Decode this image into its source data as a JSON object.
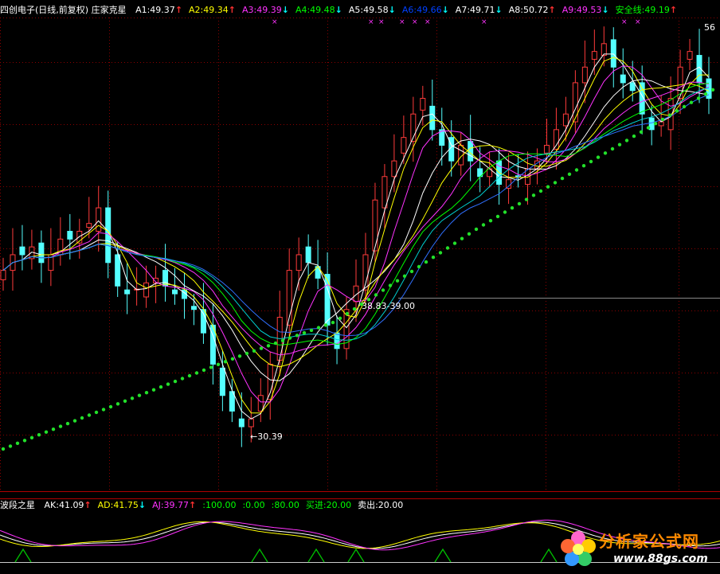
{
  "colors": {
    "background": "#000000",
    "up_candle": "#ff3b3b",
    "down_candle": "#54ffff",
    "safety_dots": "#22e02a",
    "grid": "#8a0000",
    "ma_white": "#ffffff",
    "ma_yellow": "#ffff00",
    "ma_magenta": "#ff33ff",
    "ma_green": "#00ff00",
    "ma_blue": "#3070ff",
    "ma_cyan": "#00d0d0",
    "triangle": "#00c000"
  },
  "main_header": {
    "title": "四创电子(日线,前复权) 庄家克星",
    "items": [
      {
        "label": "A1:49.37",
        "arrow": "↑",
        "color": "#ffffff",
        "arrow_color": "#ff3030"
      },
      {
        "label": "A2:49.34",
        "arrow": "↑",
        "color": "#ffff00",
        "arrow_color": "#ff3030"
      },
      {
        "label": "A3:49.39",
        "arrow": "↓",
        "color": "#ff33ff",
        "arrow_color": "#00ffff"
      },
      {
        "label": "A4:49.48",
        "arrow": "↓",
        "color": "#00ff00",
        "arrow_color": "#00ffff"
      },
      {
        "label": "A5:49.58",
        "arrow": "↓",
        "color": "#ffffff",
        "arrow_color": "#00ffff"
      },
      {
        "label": "A6:49.66",
        "arrow": "↓",
        "color": "#0040ff",
        "arrow_color": "#00ffff"
      },
      {
        "label": "A7:49.71",
        "arrow": "↓",
        "color": "#ffffff",
        "arrow_color": "#00ffff"
      },
      {
        "label": "A8:50.72",
        "arrow": "↑",
        "color": "#ffffff",
        "arrow_color": "#ff3030"
      },
      {
        "label": "A9:49.53",
        "arrow": "↓",
        "color": "#ff33ff",
        "arrow_color": "#00ffff"
      },
      {
        "label": "安全线:49.19",
        "arrow": "↑",
        "color": "#00ff00",
        "arrow_color": "#ff3030"
      }
    ]
  },
  "sub_header": {
    "title": "波段之星",
    "items": [
      {
        "label": "AK:41.09",
        "arrow": "↑",
        "color": "#ffffff",
        "arrow_color": "#ff3030"
      },
      {
        "label": "AD:41.75",
        "arrow": "↓",
        "color": "#ffff00",
        "arrow_color": "#00ffff"
      },
      {
        "label": "AJ:39.77",
        "arrow": "↑",
        "color": "#ff33ff",
        "arrow_color": "#ff3030"
      },
      {
        "label": ":100.00",
        "arrow": "",
        "color": "#00ff00",
        "arrow_color": ""
      },
      {
        "label": ":0.00",
        "arrow": "",
        "color": "#00ff00",
        "arrow_color": ""
      },
      {
        "label": ":80.00",
        "arrow": "",
        "color": "#00ff00",
        "arrow_color": ""
      },
      {
        "label": "买进:20.00",
        "arrow": "",
        "color": "#00ff00",
        "arrow_color": ""
      },
      {
        "label": "卖出:20.00",
        "arrow": "",
        "color": "#ffffff",
        "arrow_color": ""
      }
    ]
  },
  "annotations": {
    "low_price": "←30.39",
    "mid_price": "38.83-39.00",
    "high_price": "56"
  },
  "watermark": {
    "title": "分析家公式网",
    "url": "www.88gs.com"
  },
  "chart_data": {
    "type": "candlestick",
    "stock": "四创电子",
    "period": "日线",
    "adjust": "前复权",
    "indicator_main": "庄家克星",
    "indicator_sub": "波段之星",
    "visible_low": 30.39,
    "visible_high": 56,
    "annotated_level": "38.83-39.00",
    "indicator_values": {
      "A1": 49.37,
      "A2": 49.34,
      "A3": 49.39,
      "A4": 49.48,
      "A5": 49.58,
      "A6": 49.66,
      "A7": 49.71,
      "A8": 50.72,
      "A9": 49.53,
      "安全线": 49.19
    },
    "sub_values": {
      "AK": 41.09,
      "AD": 41.75,
      "AJ": 39.77,
      "levels": [
        100.0,
        0.0,
        80.0
      ],
      "买进": 20.0,
      "卖出": 20.0
    }
  }
}
